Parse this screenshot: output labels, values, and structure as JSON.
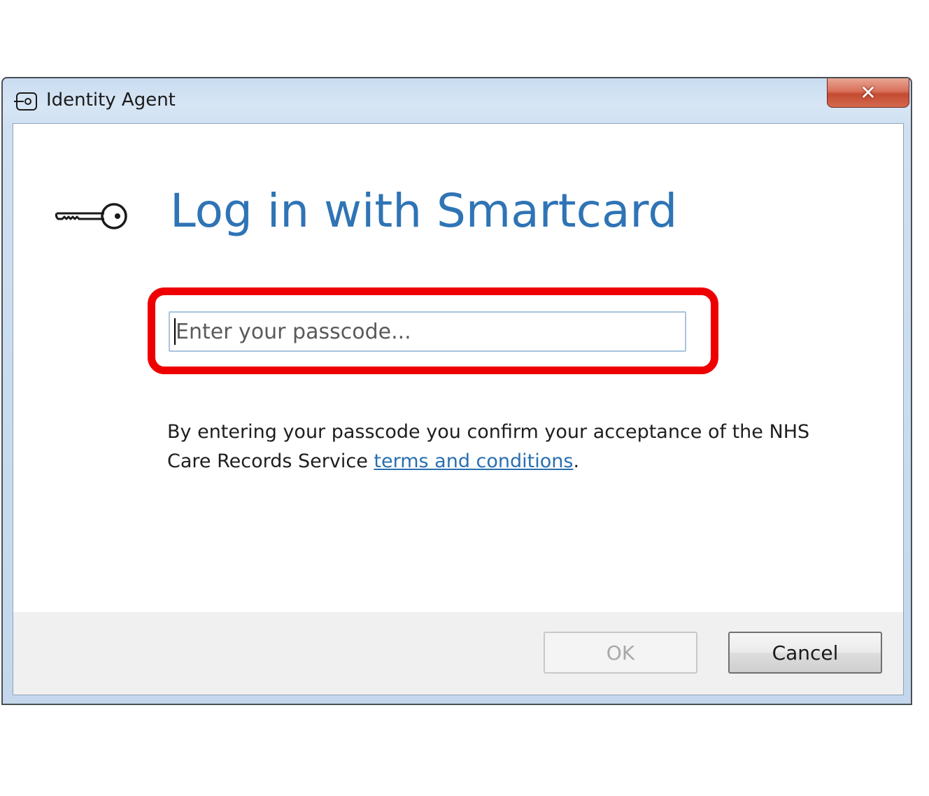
{
  "window": {
    "title": "Identity Agent",
    "title_icon": "key-tag-icon",
    "close_glyph": "✕"
  },
  "dialog": {
    "heading": "Log in with Smartcard",
    "heading_icon": "key-icon",
    "passcode": {
      "value": "",
      "placeholder": "Enter your passcode..."
    },
    "disclaimer_prefix": "By entering your passcode you confirm your acceptance of the NHS Care Records Service ",
    "disclaimer_link": "terms and conditions",
    "disclaimer_suffix": "."
  },
  "buttons": {
    "ok_label": "OK",
    "cancel_label": "Cancel"
  },
  "colors": {
    "heading": "#2f74b5",
    "highlight": "#ee0000",
    "link": "#2a6fb0"
  }
}
